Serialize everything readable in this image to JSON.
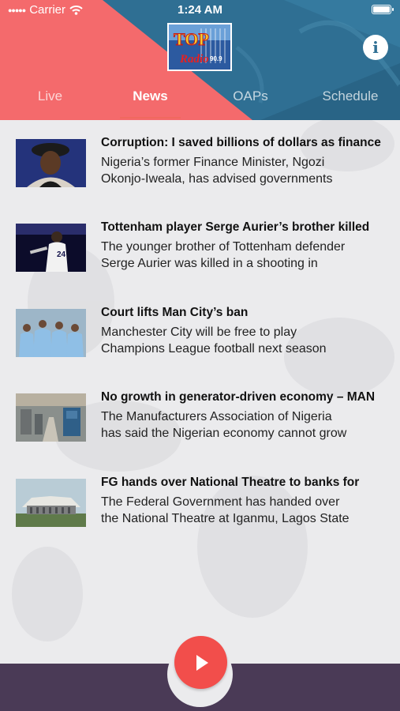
{
  "status_bar": {
    "carrier": "Carrier",
    "time": "1:24 AM"
  },
  "header": {
    "logo_text_top": "TOP",
    "logo_text_radio": "Radio",
    "logo_text_freq": "90.9",
    "info_label": "i",
    "colors": {
      "coral": "#f46a6c",
      "blue": "#2f6f93"
    }
  },
  "tabs": [
    {
      "label": "Live",
      "active": false
    },
    {
      "label": "News",
      "active": true
    },
    {
      "label": "OAPs",
      "active": false
    },
    {
      "label": "Schedule",
      "active": false
    }
  ],
  "news": [
    {
      "headline": "Corruption: I saved billions of dollars as finance",
      "excerpt_line1": "Nigeria’s former Finance Minister, Ngozi",
      "excerpt_line2": "Okonjo-Iweala, has advised governments",
      "thumb_icon": "portrait-photo"
    },
    {
      "headline": "Tottenham player Serge Aurier’s brother killed",
      "excerpt_line1": "The younger brother of Tottenham defender",
      "excerpt_line2": "Serge Aurier was killed in a shooting in",
      "thumb_icon": "footballer-photo"
    },
    {
      "headline": "Court lifts Man City’s ban",
      "excerpt_line1": "Manchester City will be free to play",
      "excerpt_line2": "Champions League football next season",
      "thumb_icon": "team-photo"
    },
    {
      "headline": "No growth in generator-driven economy – MAN",
      "excerpt_line1": "The Manufacturers Association of Nigeria",
      "excerpt_line2": "has said the Nigerian economy cannot grow",
      "thumb_icon": "factory-photo"
    },
    {
      "headline": "FG hands over National Theatre to banks for",
      "excerpt_line1": "The Federal Government has handed over",
      "excerpt_line2": "the National Theatre at Iganmu, Lagos State",
      "thumb_icon": "theatre-photo"
    }
  ],
  "player": {
    "play_icon": "play-icon",
    "colors": {
      "play": "#f24e4b",
      "bar": "#4a3a56"
    }
  }
}
